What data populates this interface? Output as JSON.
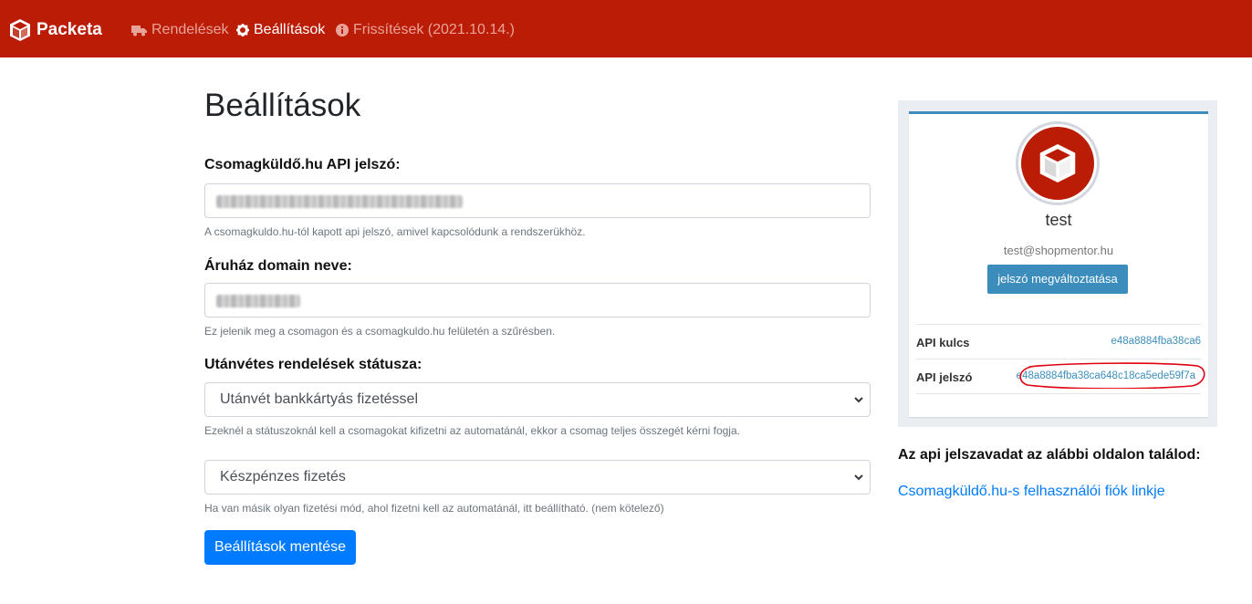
{
  "navbar": {
    "brand": "Packeta",
    "links": [
      {
        "label": "Rendelések",
        "icon": "truck-icon",
        "active": false
      },
      {
        "label": "Beállítások",
        "icon": "gear-icon",
        "active": true
      },
      {
        "label": "Frissítések (2021.10.14.)",
        "icon": "info-icon",
        "active": false
      }
    ]
  },
  "main": {
    "title": "Beállítások",
    "api_password": {
      "label": "Csomagküldő.hu API jelszó:",
      "help": "A csomagkuldo.hu-tól kapott api jelszó, amivel kapcsolódunk a rendszerükhöz."
    },
    "domain": {
      "label": "Áruház domain neve:",
      "help": "Ez jelenik meg a csomagon és a csomagkuldo.hu felületén a szűrésben."
    },
    "cod_status": {
      "label": "Utánvétes rendelések státusza:",
      "selected": "Utánvét bankkártyás fizetéssel",
      "help": "Ezeknél a státuszoknál kell a csomagokat kifizetni az automatánál, ekkor a csomag teljes összegét kérni fogja."
    },
    "other_payment": {
      "selected": "Készpénzes fizetés",
      "help": "Ha van másik olyan fizetési mód, ahol fizetni kell az automatánál, itt beállítható. (nem kötelező)"
    },
    "save_button": "Beállítások mentése"
  },
  "profile": {
    "name": "test",
    "email": "test@shopmentor.hu",
    "change_password_button": "jelszó megváltoztatása",
    "api_key_label": "API kulcs",
    "api_key_value": "e48a8884fba38ca6",
    "api_password_label": "API jelszó",
    "api_password_value": "e48a8884fba38ca648c18ca5ede59f7a"
  },
  "info": {
    "text": "Az api jelszavadat az alábbi oldalon találod:",
    "link": "Csomagküldő.hu-s felhasználói fiók linkje"
  },
  "colors": {
    "navbar": "#bb1c05",
    "primary": "#007bff",
    "card_accent": "#3c8dbc",
    "annotation": "#e0000f"
  }
}
